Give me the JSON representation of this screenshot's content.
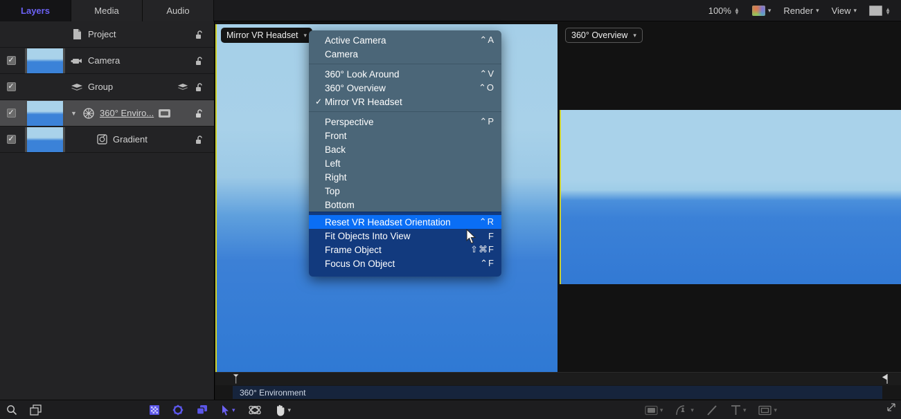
{
  "topbar": {
    "tabs": [
      {
        "label": "Layers",
        "active": true
      },
      {
        "label": "Media",
        "active": false
      },
      {
        "label": "Audio",
        "active": false
      }
    ],
    "zoom_value": "100%",
    "render_label": "Render",
    "view_label": "View",
    "icons": {
      "zoom_stepper": "stepper-updown-icon",
      "color_swatch": "gradient-swatch-icon",
      "render_chevron": "chevron-down-icon",
      "view_chevron": "chevron-down-icon",
      "layout_swatch": "layout-swatch-icon",
      "layout_stepper": "stepper-updown-icon"
    }
  },
  "layers": {
    "rows": [
      {
        "name": "Project",
        "checked": false,
        "has_thumb": false,
        "icon": "document-icon",
        "indent": 0,
        "selected": false,
        "underline": false,
        "badge": false,
        "disclosure": "",
        "group_icon": false,
        "lock": "lock-open-icon"
      },
      {
        "name": "Camera",
        "checked": true,
        "has_thumb": true,
        "icon": "camera-icon",
        "indent": 0,
        "selected": false,
        "underline": false,
        "badge": false,
        "disclosure": "",
        "group_icon": false,
        "lock": "lock-open-icon"
      },
      {
        "name": "Group",
        "checked": true,
        "has_thumb": false,
        "icon": "group-layers-icon",
        "indent": 0,
        "selected": false,
        "underline": false,
        "badge": false,
        "disclosure": "",
        "group_icon": true,
        "lock": "lock-open-icon"
      },
      {
        "name": "360° Enviro...",
        "checked": true,
        "has_thumb": true,
        "icon": "360-environment-icon",
        "indent": 1,
        "selected": true,
        "underline": true,
        "badge": true,
        "disclosure": "▼",
        "group_icon": false,
        "lock": "lock-open-icon"
      },
      {
        "name": "Gradient",
        "checked": true,
        "has_thumb": true,
        "icon": "gradient-icon",
        "indent": 2,
        "selected": false,
        "underline": false,
        "badge": false,
        "disclosure": "",
        "group_icon": false,
        "lock": "lock-open-icon"
      }
    ]
  },
  "canvas": {
    "left_view_button": "Mirror VR Headset",
    "right_view_button": "360° Overview",
    "chevron": "chevron-down-icon"
  },
  "menu": {
    "groups": [
      {
        "dark": false,
        "items": [
          {
            "label": "Active Camera",
            "shortcut": "⌃A",
            "checked": false
          },
          {
            "label": "Camera",
            "shortcut": "",
            "checked": false
          }
        ]
      },
      {
        "dark": false,
        "items": [
          {
            "label": "360° Look Around",
            "shortcut": "⌃V",
            "checked": false
          },
          {
            "label": "360° Overview",
            "shortcut": "⌃O",
            "checked": false
          },
          {
            "label": "Mirror VR Headset",
            "shortcut": "",
            "checked": true
          }
        ]
      },
      {
        "dark": false,
        "items": [
          {
            "label": "Perspective",
            "shortcut": "⌃P",
            "checked": false
          },
          {
            "label": "Front",
            "shortcut": "",
            "checked": false
          },
          {
            "label": "Back",
            "shortcut": "",
            "checked": false
          },
          {
            "label": "Left",
            "shortcut": "",
            "checked": false
          },
          {
            "label": "Right",
            "shortcut": "",
            "checked": false
          },
          {
            "label": "Top",
            "shortcut": "",
            "checked": false
          },
          {
            "label": "Bottom",
            "shortcut": "",
            "checked": false
          }
        ]
      },
      {
        "dark": true,
        "items": [
          {
            "label": "Reset VR Headset Orientation",
            "shortcut": "⌃R",
            "checked": false,
            "highlighted": true
          },
          {
            "label": "Fit Objects Into View",
            "shortcut": "F",
            "checked": false
          },
          {
            "label": "Frame Object",
            "shortcut": "⇧⌘F",
            "checked": false
          },
          {
            "label": "Focus On Object",
            "shortcut": "⌃F",
            "checked": false
          }
        ]
      }
    ],
    "highlight_color": "#0a6ef5",
    "background_color": "#4b6678",
    "dark_background_color": "#123a7e"
  },
  "timeline": {
    "track_label": "360° Environment",
    "playhead_icon": "playhead-marker-icon",
    "end_marker_icon": "end-marker-icon"
  },
  "bottombar": {
    "left_tools": [
      {
        "icon": "search-icon"
      },
      {
        "icon": "frame-layer-icon"
      }
    ],
    "left_right_tools": [
      {
        "icon": "checkerboard-icon"
      },
      {
        "icon": "gear-icon"
      },
      {
        "icon": "layers-stack-icon"
      }
    ],
    "canvas_tools": [
      {
        "icon": "arrow-select-icon",
        "chevron": true
      },
      {
        "icon": "3d-transform-icon",
        "chevron": false
      },
      {
        "icon": "hand-pan-icon",
        "chevron": true
      }
    ],
    "canvas_right_tools": [
      {
        "icon": "shape-rect-icon",
        "chevron": true
      },
      {
        "icon": "bezier-pen-icon",
        "chevron": true
      },
      {
        "icon": "paint-stroke-icon",
        "chevron": false
      },
      {
        "icon": "text-tool-icon",
        "chevron": true
      },
      {
        "icon": "mask-icon",
        "chevron": true
      }
    ],
    "resize_grip": "resize-grip-icon"
  },
  "colors": {
    "accent_purple": "#6c62f5",
    "canvas_border_yellow": "#cfd12a",
    "menu_highlight_blue": "#0a6ef5",
    "sky_blue": "#a9d2ea",
    "ocean_blue": "#3279d4"
  }
}
